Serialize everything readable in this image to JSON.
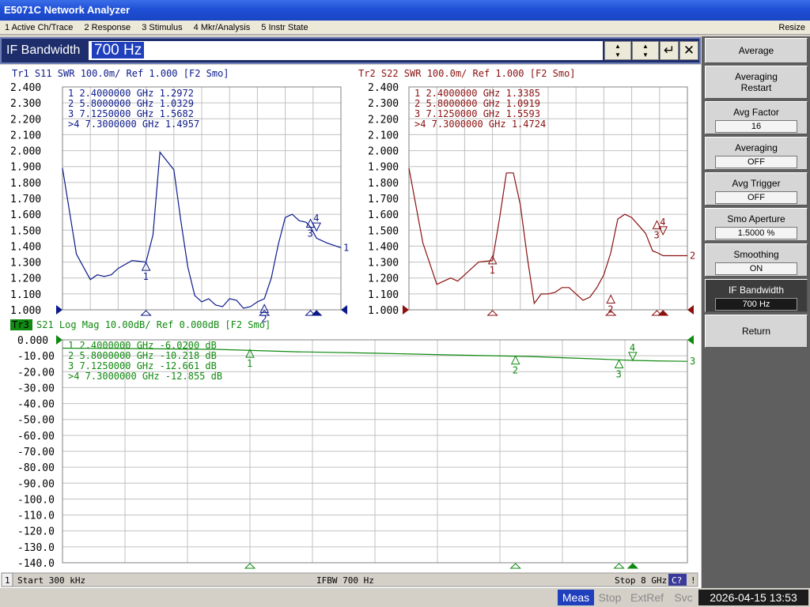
{
  "window": {
    "title": "E5071C Network Analyzer"
  },
  "menu": {
    "items": [
      "1 Active Ch/Trace",
      "2 Response",
      "3 Stimulus",
      "4 Mkr/Analysis",
      "5 Instr State"
    ],
    "resize": "Resize"
  },
  "entry": {
    "label": "IF Bandwidth",
    "value": "700 Hz",
    "enter_glyph": "↵",
    "close_glyph": "✕"
  },
  "softkeys": {
    "title": "Average",
    "items": [
      {
        "line1": "Averaging",
        "line2": "Restart",
        "value": ""
      },
      {
        "line1": "Avg Factor",
        "line2": "",
        "value": "16"
      },
      {
        "line1": "Averaging",
        "line2": "",
        "value": "OFF"
      },
      {
        "line1": "Avg Trigger",
        "line2": "",
        "value": "OFF"
      },
      {
        "line1": "Smo Aperture",
        "line2": "",
        "value": "1.5000  %"
      },
      {
        "line1": "Smoothing",
        "line2": "",
        "value": "ON"
      },
      {
        "line1": "IF Bandwidth",
        "line2": "",
        "value": "700 Hz",
        "active": true
      },
      {
        "line1": "Return",
        "line2": "",
        "value": ""
      }
    ]
  },
  "channel_status": {
    "channel_number": "1",
    "start": "Start 300 kHz",
    "ifbw": "IFBW 700 Hz",
    "stop": "Stop 8 GHz",
    "cal_indicator": "C?",
    "warn_indicator": "!"
  },
  "instrument_status": {
    "meas": "Meas",
    "stop": "Stop",
    "extref": "ExtRef",
    "svc": "Svc",
    "datetime": "2026-04-15 13:53"
  },
  "colors": {
    "tr1": "#0c1a8a",
    "tr2": "#8b1010",
    "tr3": "#108a10",
    "grid": "#c0c0c0"
  },
  "chart_data": [
    {
      "type": "line",
      "title": "Tr1  S11  SWR 100.0m/  Ref 1.000  [F2 Smo]",
      "trace_label": "1",
      "ylim": [
        1.0,
        2.4
      ],
      "ytick_labels": [
        "2.400",
        "2.300",
        "2.200",
        "2.100",
        "2.000",
        "1.900",
        "1.800",
        "1.700",
        "1.600",
        "1.500",
        "1.400",
        "1.300",
        "1.200",
        "1.100",
        "1.000"
      ],
      "xlim": [
        0.0003,
        8.0
      ],
      "x_unit": "GHz",
      "x": [
        0.0003,
        0.4,
        0.8,
        1.0,
        1.2,
        1.4,
        1.6,
        2.0,
        2.4,
        2.6,
        2.8,
        3.2,
        3.4,
        3.6,
        3.8,
        4.0,
        4.2,
        4.4,
        4.6,
        4.8,
        5.0,
        5.2,
        5.4,
        5.6,
        5.8,
        6.0,
        6.2,
        6.4,
        6.6,
        6.8,
        7.0,
        7.125,
        7.3,
        7.6,
        8.0
      ],
      "y": [
        1.89,
        1.35,
        1.19,
        1.22,
        1.21,
        1.22,
        1.26,
        1.31,
        1.3,
        1.47,
        1.99,
        1.88,
        1.56,
        1.27,
        1.09,
        1.05,
        1.07,
        1.03,
        1.02,
        1.07,
        1.06,
        1.01,
        1.02,
        1.05,
        1.07,
        1.2,
        1.41,
        1.58,
        1.6,
        1.56,
        1.55,
        1.52,
        1.45,
        1.42,
        1.39
      ],
      "markers": [
        {
          "label": "1",
          "x": 2.4,
          "y": 1.2972
        },
        {
          "label": "2",
          "x": 5.8,
          "y": 1.0329
        },
        {
          "label": "3",
          "x": 7.125,
          "y": 1.5682
        },
        {
          "label": "4",
          "x": 7.3,
          "y": 1.4957
        }
      ],
      "marker_table": [
        "1   2.4000000  GHz  1.2972",
        "2   5.8000000  GHz  1.0329",
        "3   7.1250000  GHz  1.5682",
        ">4  7.3000000  GHz  1.4957"
      ]
    },
    {
      "type": "line",
      "title": "Tr2  S22  SWR 100.0m/  Ref 1.000  [F2 Smo]",
      "trace_label": "2",
      "ylim": [
        1.0,
        2.4
      ],
      "ytick_labels": [
        "2.400",
        "2.300",
        "2.200",
        "2.100",
        "2.000",
        "1.900",
        "1.800",
        "1.700",
        "1.600",
        "1.500",
        "1.400",
        "1.300",
        "1.200",
        "1.100",
        "1.000"
      ],
      "xlim": [
        0.0003,
        8.0
      ],
      "x_unit": "GHz",
      "x": [
        0.0003,
        0.4,
        0.8,
        1.0,
        1.2,
        1.4,
        1.6,
        2.0,
        2.4,
        2.6,
        2.8,
        3.0,
        3.2,
        3.4,
        3.6,
        3.8,
        4.0,
        4.2,
        4.4,
        4.6,
        4.8,
        5.0,
        5.2,
        5.4,
        5.6,
        5.8,
        6.0,
        6.2,
        6.4,
        6.6,
        6.8,
        7.0,
        7.125,
        7.3,
        7.6,
        8.0
      ],
      "y": [
        1.89,
        1.42,
        1.16,
        1.18,
        1.2,
        1.18,
        1.22,
        1.3,
        1.31,
        1.57,
        1.86,
        1.86,
        1.66,
        1.33,
        1.04,
        1.1,
        1.1,
        1.11,
        1.14,
        1.14,
        1.1,
        1.06,
        1.08,
        1.14,
        1.22,
        1.36,
        1.57,
        1.6,
        1.58,
        1.53,
        1.48,
        1.37,
        1.36,
        1.34,
        1.34,
        1.34
      ],
      "markers": [
        {
          "label": "1",
          "x": 2.4,
          "y": 1.3385
        },
        {
          "label": "2",
          "x": 5.8,
          "y": 1.0919
        },
        {
          "label": "3",
          "x": 7.125,
          "y": 1.5593
        },
        {
          "label": "4",
          "x": 7.3,
          "y": 1.4724
        }
      ],
      "marker_table": [
        "1   2.4000000  GHz  1.3385",
        "2   5.8000000  GHz  1.0919",
        "3   7.1250000  GHz  1.5593",
        ">4  7.3000000  GHz  1.4724"
      ]
    },
    {
      "type": "line",
      "title": "S21  Log Mag  10.00dB/  Ref 0.000dB  [F2 Smo]",
      "trace_badge": "Tr3",
      "trace_label": "3",
      "ylim": [
        -140,
        0
      ],
      "ytick_labels": [
        "0.000",
        "-10.00",
        "-20.00",
        "-30.00",
        "-40.00",
        "-50.00",
        "-60.00",
        "-70.00",
        "-80.00",
        "-90.00",
        "-100.0",
        "-110.0",
        "-120.0",
        "-130.0",
        "-140.0"
      ],
      "xlim": [
        0.0003,
        8.0
      ],
      "x_unit": "GHz",
      "x": [
        0.0003,
        1.0,
        2.0,
        3.0,
        4.0,
        5.0,
        6.0,
        7.0,
        7.3,
        7.6,
        8.0
      ],
      "y": [
        -5.2,
        -5.5,
        -6.0,
        -7.5,
        -8.4,
        -9.5,
        -10.5,
        -12.3,
        -12.9,
        -13.2,
        -13.5
      ],
      "markers": [
        {
          "label": "1",
          "x": 2.4,
          "y": -6.02
        },
        {
          "label": "2",
          "x": 5.8,
          "y": -10.218
        },
        {
          "label": "3",
          "x": 7.125,
          "y": -12.661
        },
        {
          "label": "4",
          "x": 7.3,
          "y": -12.855
        }
      ],
      "marker_table": [
        "1   2.4000000  GHz  -6.0200  dB",
        "2   5.8000000  GHz  -10.218  dB",
        "3   7.1250000  GHz  -12.661  dB",
        ">4  7.3000000  GHz  -12.855  dB"
      ]
    }
  ]
}
